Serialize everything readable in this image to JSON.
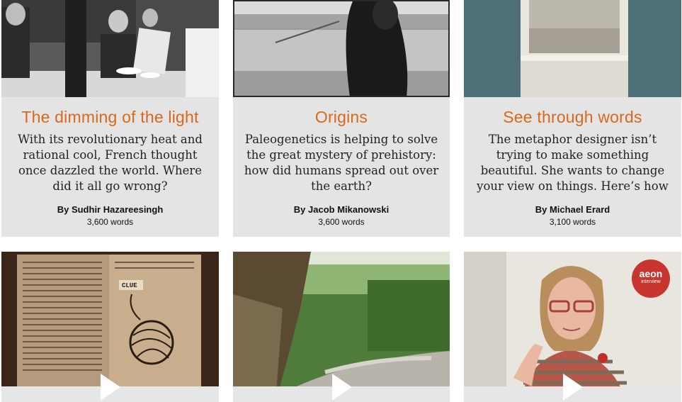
{
  "articles": [
    {
      "title": "The dimming of the light",
      "description": "With its revolutionary heat and rational cool, French thought once dazzled the world. Where did it all go wrong?",
      "author": "By Sudhir Hazareesingh",
      "words": "3,600 words"
    },
    {
      "title": "Origins",
      "description": "Paleogenetics is helping to solve the great mystery of prehistory: how did humans spread out over the earth?",
      "author": "By Jacob Mikanowski",
      "words": "3,600 words"
    },
    {
      "title": "See through words",
      "description": "The metaphor designer isn’t trying to make something beautiful. She wants to change your view on things. Here’s how",
      "author": "By Michael Erard",
      "words": "3,100 words"
    }
  ],
  "videos": [
    {
      "kind": "book-with-yarn-illustration",
      "label": "CLUE"
    },
    {
      "kind": "waterfall-forest"
    },
    {
      "kind": "interview",
      "badge_line1": "aeon",
      "badge_line2": "interview"
    }
  ],
  "colors": {
    "title_accent": "#d9681a",
    "card_bg": "#e4e4e4",
    "badge_red": "#c8342e"
  },
  "icons": [
    "play-icon"
  ]
}
